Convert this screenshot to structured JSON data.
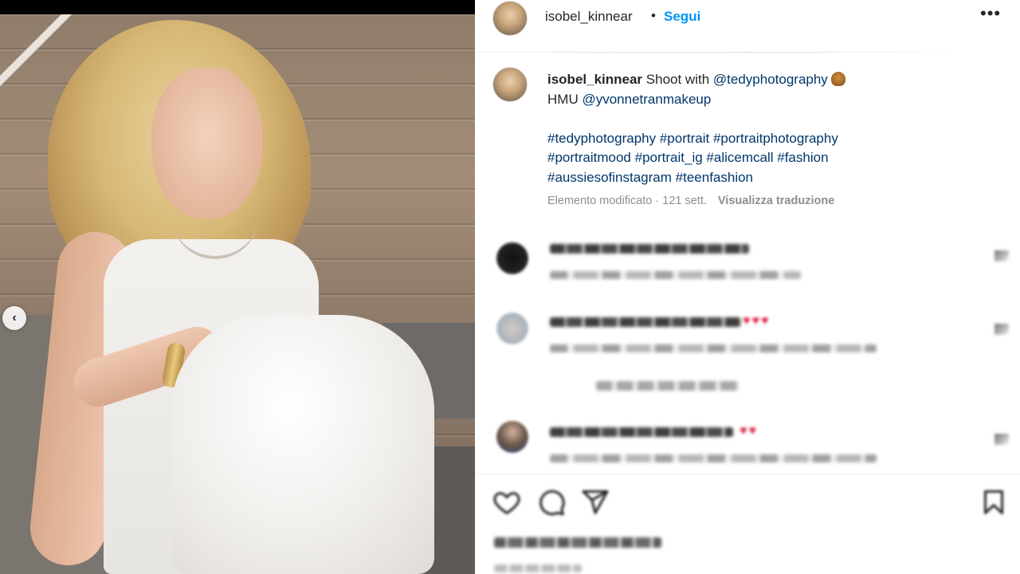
{
  "post": {
    "username": "isobel_kinnear",
    "separator": "•",
    "follow_label": "Segui",
    "more_label": "•••",
    "carousel_prev": "‹"
  },
  "caption": {
    "username": "isobel_kinnear",
    "text_line1": " Shoot with ",
    "mention_photographer": "@tedyphotography",
    "hmu_label": "HMU ",
    "mention_makeup": "@yvonnetranmakeup",
    "hashtags_line1": [
      "#tedyphotography",
      "#portrait",
      "#portraitphotography"
    ],
    "hashtags_line2": [
      "#portraitmood",
      "#portrait_ig",
      "#alicemcall",
      "#fashion"
    ],
    "hashtags_line3": [
      "#aussiesofinstagram",
      "#teenfashion"
    ],
    "edited_label": "Elemento modificato",
    "meta_sep": " · ",
    "age": "121 sett.",
    "translate_label": "Visualizza traduzione"
  },
  "icons": {
    "like": "heart-icon",
    "comment": "comment-icon",
    "share": "paper-plane-icon",
    "save": "bookmark-icon",
    "more": "more-horizontal-icon",
    "carousel": "chevron-left-icon"
  },
  "colors": {
    "link": "#00376b",
    "follow": "#0095f6",
    "muted": "#8e8e8e",
    "text": "#262626"
  }
}
